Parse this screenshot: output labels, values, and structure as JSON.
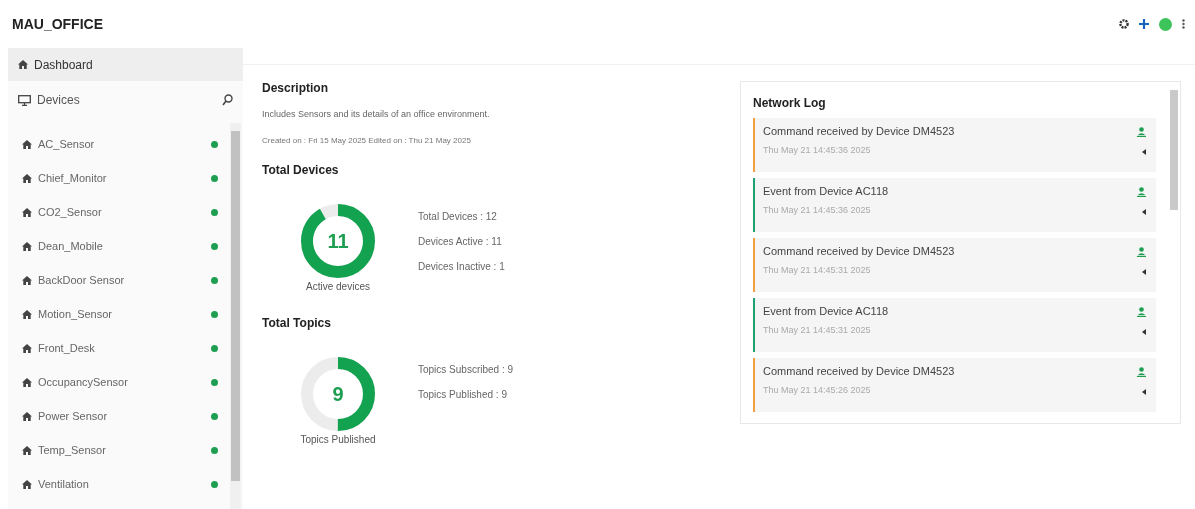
{
  "app_title": "MAU_OFFICE",
  "sidebar": {
    "items": [
      {
        "label": "Dashboard",
        "kind": "nav",
        "selected": true
      },
      {
        "label": "Devices",
        "kind": "group",
        "selected": false
      }
    ],
    "devices": [
      {
        "name": "AC_Sensor",
        "online": true
      },
      {
        "name": "Chief_Monitor",
        "online": true
      },
      {
        "name": "CO2_Sensor",
        "online": true
      },
      {
        "name": "Dean_Mobile",
        "online": true
      },
      {
        "name": "BackDoor Sensor",
        "online": true
      },
      {
        "name": "Motion_Sensor",
        "online": true
      },
      {
        "name": "Front_Desk",
        "online": true
      },
      {
        "name": "OccupancySensor",
        "online": true
      },
      {
        "name": "Power Sensor",
        "online": true
      },
      {
        "name": "Temp_Sensor",
        "online": true
      },
      {
        "name": "Ventilation",
        "online": true
      }
    ]
  },
  "description": {
    "heading": "Description",
    "text": "Includes Sensors and its details of an office environment.",
    "dates": "Created on : Fri 15 May 2025  Edited on : Thu 21 May 2025"
  },
  "sections": [
    {
      "heading": "Total Devices",
      "value": "11",
      "level": 0.917,
      "caption": "Active devices",
      "stats": [
        "Total Devices : 12",
        "Devices Active : 11",
        "Devices Inactive : 1"
      ]
    },
    {
      "heading": "Total Topics",
      "value": "9",
      "level": 0.5,
      "caption": "Topics Published",
      "stats": [
        "Topics Subscribed : 9",
        "Topics Published : 9"
      ]
    }
  ],
  "network_log": {
    "title": "Network Log",
    "entries": [
      {
        "kind": "command",
        "message": "Command received by Device DM4523",
        "time": "Thu May 21 14:45:36 2025"
      },
      {
        "kind": "event",
        "message": "Event from Device AC118",
        "time": "Thu May 21 14:45:36 2025"
      },
      {
        "kind": "command",
        "message": "Command received by Device DM4523",
        "time": "Thu May 21 14:45:31 2025"
      },
      {
        "kind": "event",
        "message": "Event from Device AC118",
        "time": "Thu May 21 14:45:31 2025"
      },
      {
        "kind": "command",
        "message": "Command received by Device DM4523",
        "time": "Thu May 21 14:45:26 2025"
      }
    ]
  }
}
